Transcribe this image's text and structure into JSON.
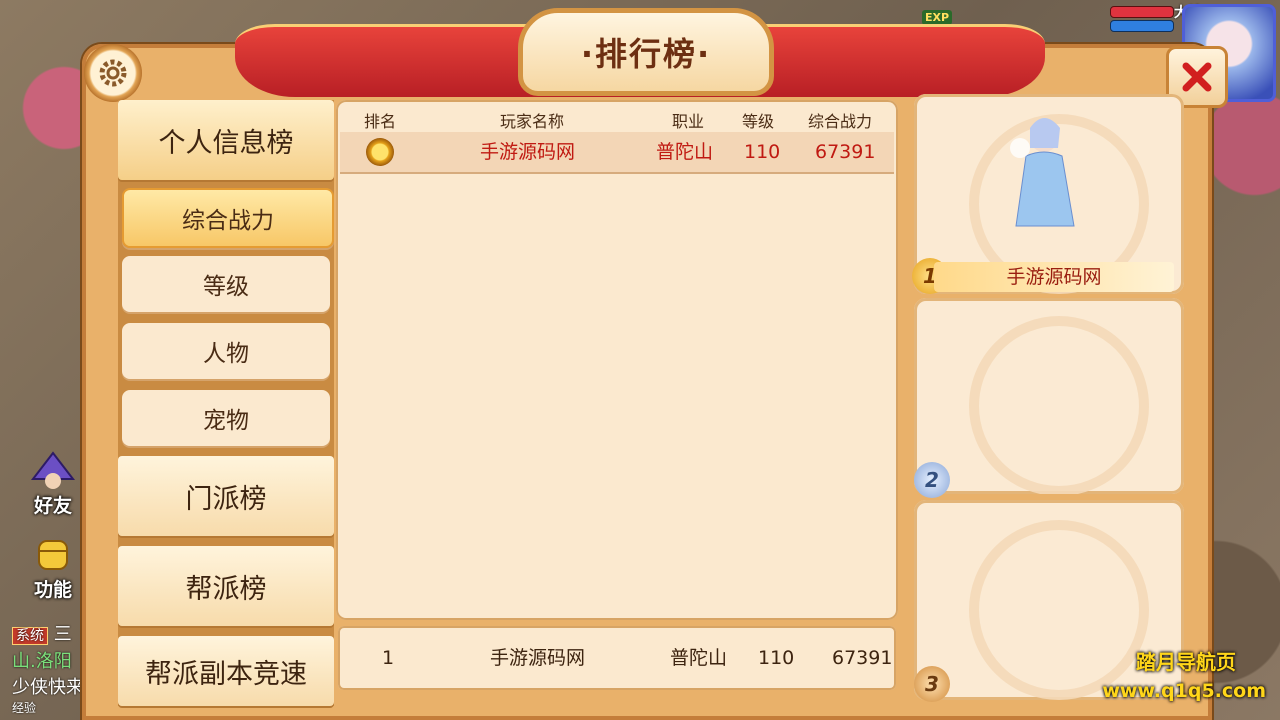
{
  "hud": {
    "exp_label": "EXP",
    "player_title": "大神"
  },
  "side_buttons": {
    "friends": "好友",
    "functions": "功能"
  },
  "chat": {
    "system_tag": "系统",
    "line1": "三",
    "line2": "山.洛阳",
    "line3": "少侠快来",
    "line4": "经验"
  },
  "window": {
    "title": "·排行榜·"
  },
  "nav": {
    "personal_category": "个人信息榜",
    "sub_items": [
      "综合战力",
      "等级",
      "人物",
      "宠物"
    ],
    "sect_category": "门派榜",
    "guild_category": "帮派榜",
    "guild_instance_category": "帮派副本竞速",
    "active_sub": "综合战力"
  },
  "table": {
    "headers": [
      "排名",
      "玩家名称",
      "职业",
      "等级",
      "综合战力"
    ],
    "rows": [
      {
        "rank_icon": "gold-medal-icon",
        "name": "手游源码网",
        "class": "普陀山",
        "level": "110",
        "power": "67391"
      }
    ]
  },
  "self_row": {
    "rank": "1",
    "name": "手游源码网",
    "class": "普陀山",
    "level": "110",
    "power": "67391"
  },
  "podium": [
    {
      "rank": "1",
      "name": "手游源码网"
    },
    {
      "rank": "2",
      "name": ""
    },
    {
      "rank": "3",
      "name": ""
    }
  ],
  "watermark": {
    "line1": "踏月导航页",
    "line2": "www.q1q5.com"
  },
  "colors": {
    "accent_red": "#c01a12",
    "panel": "#e9b16a",
    "ribbon": "#d8322f"
  }
}
